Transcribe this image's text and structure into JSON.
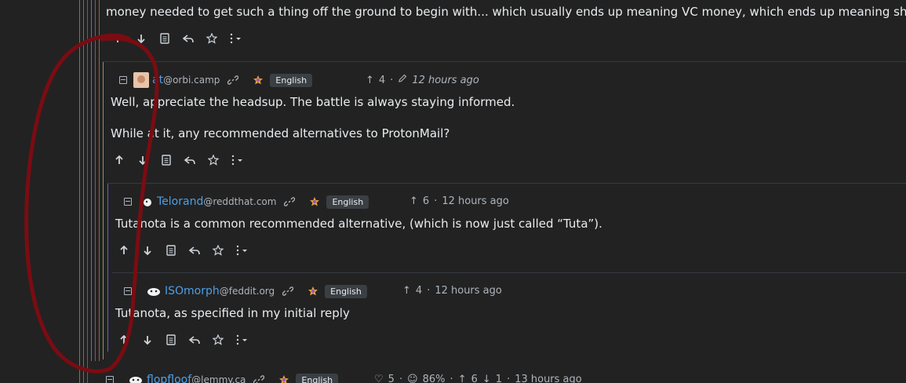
{
  "top_comment": {
    "text": "money needed to get such a thing off the ground to begin with... which usually ends up meaning VC money, which ends up meaning shady decisions"
  },
  "comments": [
    {
      "username": "at",
      "instance": "@orbi.camp",
      "language": "English",
      "score": "4",
      "timestamp": "12 hours ago",
      "body1": "Well, appreciate the headsup. The battle is always staying informed.",
      "body2": "While at it, any recommended alternatives to ProtonMail?"
    },
    {
      "username": "Telorand",
      "instance": "@reddthat.com",
      "language": "English",
      "score": "6",
      "timestamp": "12 hours ago",
      "body1": "Tutanota is a common recommended alternative, (which is now just called “Tuta”)."
    },
    {
      "username": "ISOmorph",
      "instance": "@feddit.org",
      "language": "English",
      "score": "4",
      "timestamp": "12 hours ago",
      "body1": "Tutanota, as specified in my initial reply"
    },
    {
      "username": "flopfloof",
      "instance": "@lemmy.ca",
      "language": "English",
      "likes": "5",
      "percent": "86%",
      "up": "6",
      "down": "1",
      "timestamp": "13 hours ago"
    }
  ],
  "icons": {
    "upvote": "arrow-up-icon",
    "downvote": "arrow-down-icon",
    "source": "document-icon",
    "reply": "reply-icon",
    "save": "star-icon",
    "more": "more-vertical-icon",
    "link": "link-icon",
    "language": "language-icon",
    "edited": "pencil-icon"
  },
  "colors": {
    "background": "#222222",
    "username": "#4d9fe6",
    "annotation": "#7a0c12"
  }
}
